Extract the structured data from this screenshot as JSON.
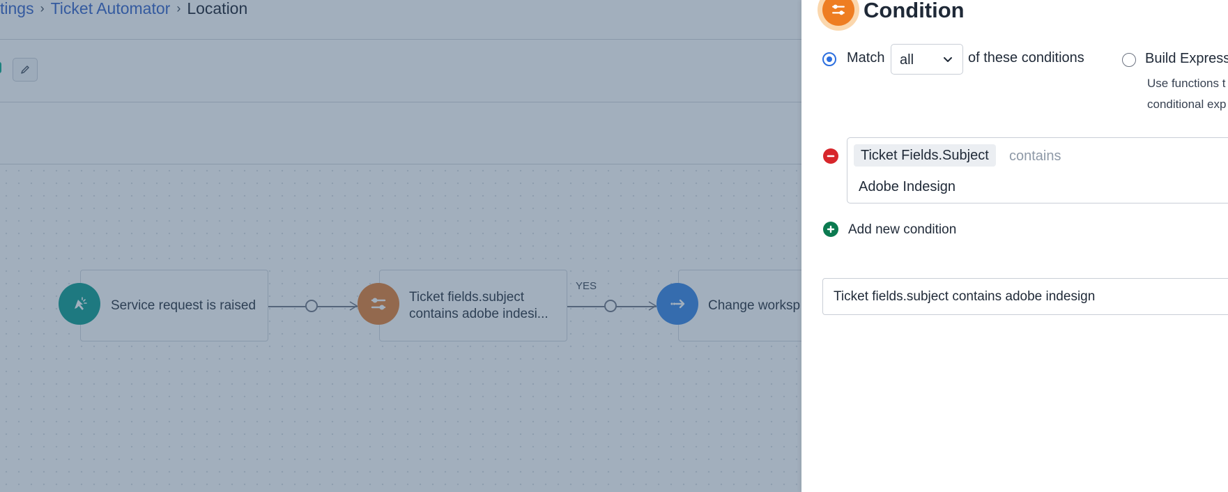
{
  "breadcrumb": {
    "items": [
      "tings",
      "Ticket Automator"
    ],
    "current": "Location",
    "separator": "›"
  },
  "workflow": {
    "nodes": [
      {
        "label": "Service request is raised",
        "icon": "cursor-click-icon",
        "color": "#03978a"
      },
      {
        "label_line1": "Ticket fields.subject",
        "label_line2": "contains adobe indesi...",
        "icon": "sliders-icon",
        "color": "#e27a2b"
      },
      {
        "label": "Change worksp",
        "icon": "arrow-right-icon",
        "color": "#2f7fe3"
      }
    ],
    "edge_labels": [
      "YES"
    ]
  },
  "panel": {
    "title": "Condition",
    "title_icon": "sliders-icon",
    "match_label": "Match",
    "match_value": "all",
    "match_suffix": "of these conditions",
    "build_label": "Build Express",
    "helper_line1": "Use functions t",
    "helper_line2": "conditional exp",
    "condition": {
      "field": "Ticket Fields.Subject",
      "operator": "contains",
      "value": "Adobe Indesign"
    },
    "add_label": "Add new condition",
    "summary": "Ticket fields.subject contains adobe indesign"
  },
  "colors": {
    "link": "#2c5cc5",
    "radio_active": "#2c6fdf",
    "remove": "#d7262b",
    "add": "#0b7a50",
    "condition_icon": "#ee7d22",
    "overlay": "rgba(61, 87, 117, 0.48)"
  }
}
